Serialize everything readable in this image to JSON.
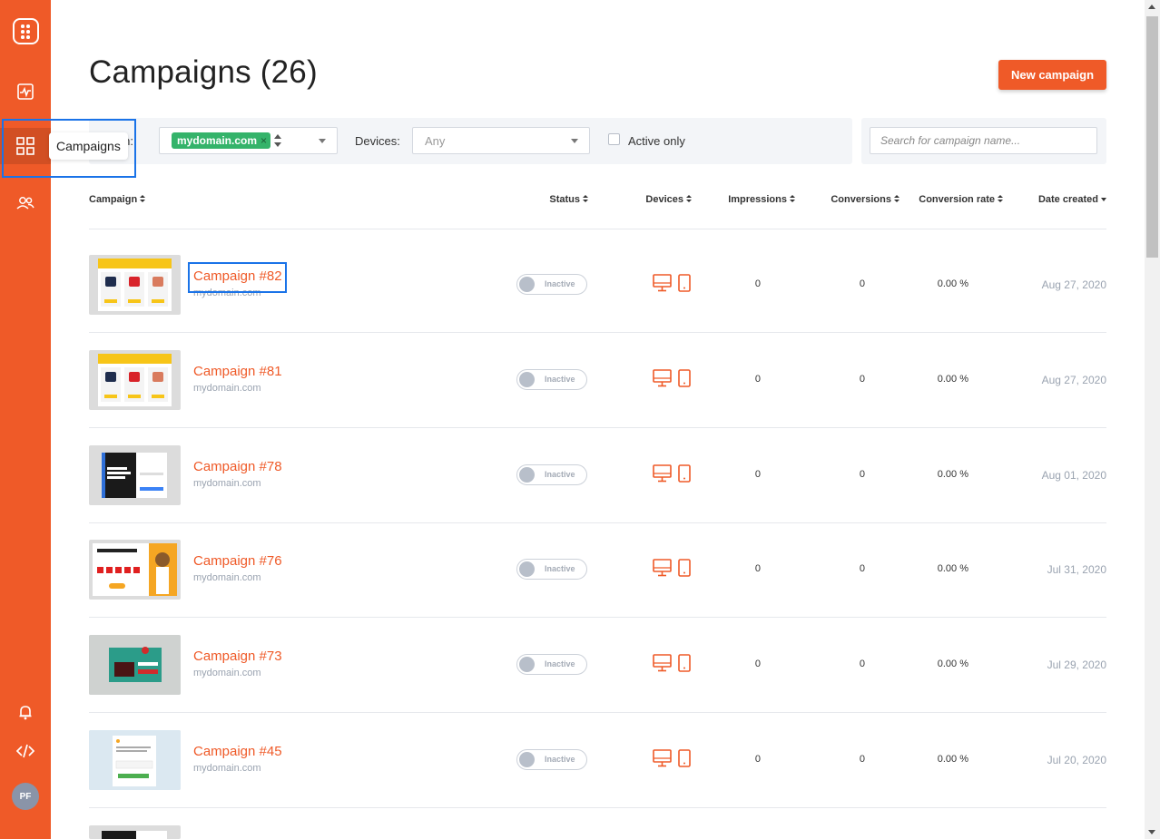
{
  "header": {
    "title": "Campaigns (26)",
    "new_campaign_label": "New campaign"
  },
  "sidebar": {
    "items": [
      {
        "name": "analytics",
        "icon": "activity-chart-icon"
      },
      {
        "name": "campaigns",
        "icon": "grid-icon",
        "active": true
      },
      {
        "name": "audience",
        "icon": "users-icon"
      },
      {
        "name": "notifications",
        "icon": "bell-icon"
      },
      {
        "name": "embed-code",
        "icon": "code-icon"
      }
    ],
    "avatar_initials": "PF",
    "tooltip": "Campaigns"
  },
  "filters": {
    "domain_label": "ain:",
    "domain_tag": "mydomain.com",
    "domain_tag_remove": "×",
    "devices_label": "Devices:",
    "devices_value": "Any",
    "active_only_label": "Active only",
    "search_placeholder": "Search for campaign name..."
  },
  "table": {
    "columns": [
      "Campaign",
      "Status",
      "Devices",
      "Impressions",
      "Conversions",
      "Conversion rate",
      "Date created"
    ],
    "rows": [
      {
        "name": "Campaign #82",
        "domain": "mydomain.com",
        "status": "Inactive",
        "impressions": "0",
        "conversions": "0",
        "conversion_rate": "0.00 %",
        "date": "Aug 27, 2020",
        "thumb": "bags"
      },
      {
        "name": "Campaign #81",
        "domain": "mydomain.com",
        "status": "Inactive",
        "impressions": "0",
        "conversions": "0",
        "conversion_rate": "0.00 %",
        "date": "Aug 27, 2020",
        "thumb": "bags"
      },
      {
        "name": "Campaign #78",
        "domain": "mydomain.com",
        "status": "Inactive",
        "impressions": "0",
        "conversions": "0",
        "conversion_rate": "0.00 %",
        "date": "Aug 01, 2020",
        "thumb": "dark"
      },
      {
        "name": "Campaign #76",
        "domain": "mydomain.com",
        "status": "Inactive",
        "impressions": "0",
        "conversions": "0",
        "conversion_rate": "0.00 %",
        "date": "Jul 31, 2020",
        "thumb": "gift"
      },
      {
        "name": "Campaign #73",
        "domain": "mydomain.com",
        "status": "Inactive",
        "impressions": "0",
        "conversions": "0",
        "conversion_rate": "0.00 %",
        "date": "Jul 29, 2020",
        "thumb": "xmas"
      },
      {
        "name": "Campaign #45",
        "domain": "mydomain.com",
        "status": "Inactive",
        "impressions": "0",
        "conversions": "0",
        "conversion_rate": "0.00 %",
        "date": "Jul 20, 2020",
        "thumb": "form"
      }
    ]
  },
  "colors": {
    "brand": "#ef5a28",
    "tag": "#34b36a",
    "highlight": "#1a73e8"
  }
}
